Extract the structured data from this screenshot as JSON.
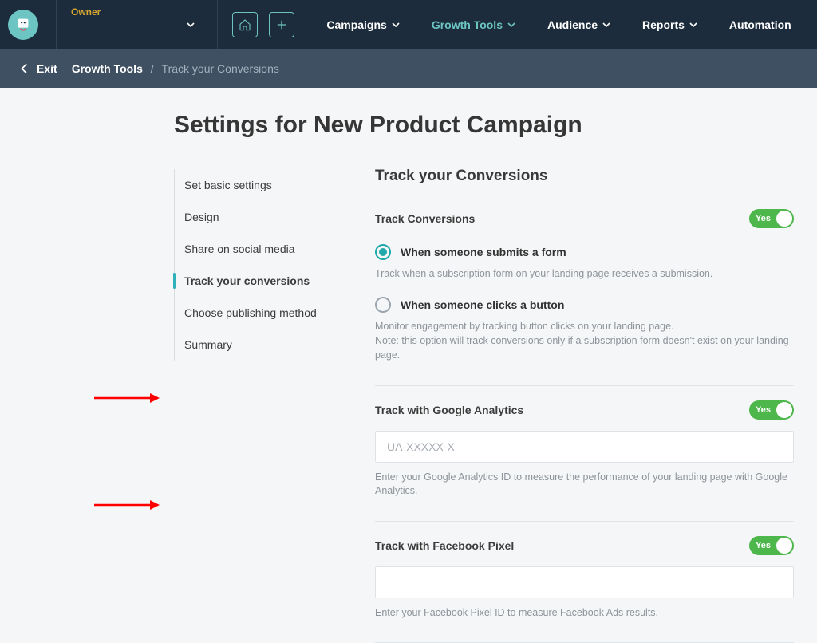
{
  "header": {
    "owner_label": "Owner",
    "nav": {
      "campaigns": "Campaigns",
      "growth_tools": "Growth Tools",
      "audience": "Audience",
      "reports": "Reports",
      "automation": "Automation"
    }
  },
  "breadcrumb": {
    "exit": "Exit",
    "part1": "Growth Tools",
    "sep": "/",
    "current": "Track your Conversions"
  },
  "page": {
    "title": "Settings for New Product Campaign"
  },
  "steps": {
    "basic": "Set basic settings",
    "design": "Design",
    "share": "Share on social media",
    "track": "Track your conversions",
    "publish": "Choose publishing method",
    "summary": "Summary"
  },
  "settings": {
    "section_title": "Track your Conversions",
    "track_conversions": {
      "label": "Track Conversions",
      "toggle": "Yes",
      "opt_form": "When someone submits a form",
      "opt_form_desc": "Track when a subscription form on your landing page receives a submission.",
      "opt_button": "When someone clicks a button",
      "opt_button_desc": "Monitor engagement by tracking button clicks on your landing page.\nNote: this option will track conversions only if a subscription form doesn't exist on your landing page."
    },
    "ga": {
      "label": "Track with Google Analytics",
      "toggle": "Yes",
      "placeholder": "UA-XXXXX-X",
      "helper": "Enter your Google Analytics ID to measure the performance of your landing page with Google Analytics."
    },
    "fb": {
      "label": "Track with Facebook Pixel",
      "toggle": "Yes",
      "helper": "Enter your Facebook Pixel ID to measure Facebook Ads results."
    }
  }
}
